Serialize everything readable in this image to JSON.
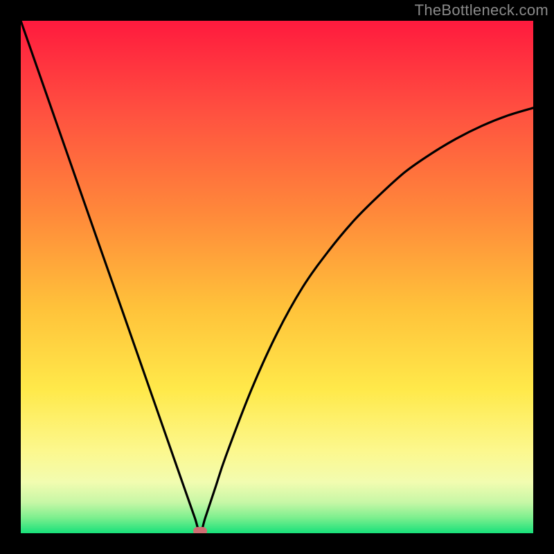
{
  "watermark": "TheBottleneck.com",
  "colors": {
    "page_bg": "#000000",
    "curve": "#000000",
    "marker": "#cf6e73",
    "gradient_stops": [
      "#ff1a3e",
      "#ff5140",
      "#ff8a3a",
      "#ffc23a",
      "#ffe94a",
      "#fcf88e",
      "#f2fcb0",
      "#c7f7a6",
      "#7cef8e",
      "#17e07a"
    ]
  },
  "chart_data": {
    "type": "line",
    "title": "",
    "xlabel": "",
    "ylabel": "",
    "xlim": [
      0,
      100
    ],
    "ylim": [
      0,
      100
    ],
    "curve_minimum_x": 35,
    "marker": {
      "x": 35,
      "y": 0
    },
    "series": [
      {
        "name": "bottleneck-curve",
        "x": [
          0,
          5,
          10,
          15,
          20,
          25,
          30,
          32,
          34,
          35,
          36,
          38,
          40,
          45,
          50,
          55,
          60,
          65,
          70,
          75,
          80,
          85,
          90,
          95,
          100
        ],
        "values": [
          100,
          85.7,
          71.4,
          57.1,
          42.9,
          28.6,
          14.3,
          8.6,
          2.9,
          0,
          3,
          9,
          15,
          28,
          39,
          48,
          55,
          61,
          66,
          70.5,
          74,
          77,
          79.5,
          81.5,
          83
        ]
      }
    ]
  }
}
